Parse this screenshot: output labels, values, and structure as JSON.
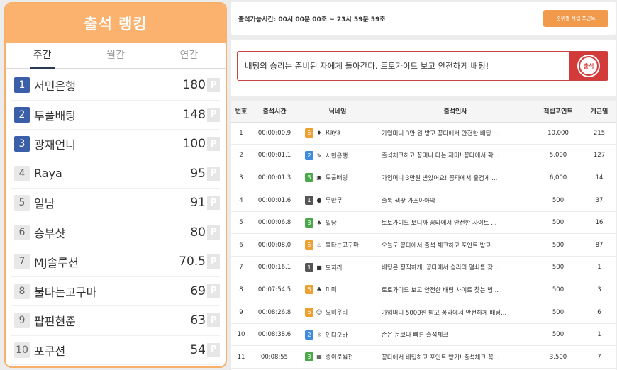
{
  "ranking": {
    "title": "출석 랭킹",
    "tabs": [
      {
        "label": "주간",
        "active": true
      },
      {
        "label": "월간",
        "active": false
      },
      {
        "label": "연간",
        "active": false
      }
    ],
    "point_badge": "P",
    "items": [
      {
        "rank": "1",
        "name": "서민은행",
        "points": "180"
      },
      {
        "rank": "2",
        "name": "투풀배팅",
        "points": "148"
      },
      {
        "rank": "3",
        "name": "광재언니",
        "points": "100"
      },
      {
        "rank": "4",
        "name": "Raya",
        "points": "95"
      },
      {
        "rank": "5",
        "name": "일남",
        "points": "91"
      },
      {
        "rank": "6",
        "name": "승부샷",
        "points": "80"
      },
      {
        "rank": "7",
        "name": "MJ솔루션",
        "points": "70.5"
      },
      {
        "rank": "8",
        "name": "불타는고구마",
        "points": "69"
      },
      {
        "rank": "9",
        "name": "팝핀현준",
        "points": "63"
      },
      {
        "rank": "10",
        "name": "포쿠션",
        "points": "54"
      }
    ]
  },
  "header": {
    "time_text": "출석가능시간: 00시 00분 00초 ~ 23시 59분 59초",
    "point_button": "순위별 적립 포인트"
  },
  "message": {
    "value": "배팅의 승리는 준비된 자에게 돌아간다. 토토가이드 보고 안전하게 배팅!",
    "submit_badge": "출석"
  },
  "table": {
    "headers": [
      "번호",
      "출석시간",
      "닉네임",
      "출석인사",
      "적립포인트",
      "개근일"
    ],
    "rows": [
      {
        "no": "1",
        "time": "00:00:00.9",
        "level": "5",
        "avatar": "♦",
        "nick": "Raya",
        "msg": "가입머니 3만 원 받고 꽁타에서 안전한 배팅 ...",
        "points": "10,000",
        "days": "215"
      },
      {
        "no": "2",
        "time": "00:00:01.1",
        "level": "2",
        "avatar": "✎",
        "nick": "서민은행",
        "msg": "출석체크하고 꽁머니 타는 재미! 꽁타에서 확...",
        "points": "5,000",
        "days": "127"
      },
      {
        "no": "3",
        "time": "00:00:01.3",
        "level": "3",
        "avatar": "▣",
        "nick": "투풀배팅",
        "msg": "가입머니 3만원 받았어요! 꽁타에서 출검게 ...",
        "points": "6,000",
        "days": "14"
      },
      {
        "no": "4",
        "time": "00:00:01.6",
        "level": "1",
        "avatar": "●",
        "nick": "무만무",
        "msg": "솔톡 잭팟 가즈아아악",
        "points": "500",
        "days": "37"
      },
      {
        "no": "5",
        "time": "00:00:06.8",
        "level": "3",
        "avatar": "♠",
        "nick": "일남",
        "msg": "토토가이드 보니까 꽁타에서 안전한 사이트 ...",
        "points": "500",
        "days": "16"
      },
      {
        "no": "6",
        "time": "00:00:08.0",
        "level": "5",
        "avatar": "♨",
        "nick": "불타는고구마",
        "msg": "오늘도 꽁타에서 출석 체크하고 포인트 받고...",
        "points": "500",
        "days": "87"
      },
      {
        "no": "7",
        "time": "00:00:16.1",
        "level": "1",
        "avatar": "■",
        "nick": "모지리",
        "msg": "배팅은 정직하게, 꽁타에서 승리의 열쇠를 찾...",
        "points": "500",
        "days": "1"
      },
      {
        "no": "8",
        "time": "00:07:54.5",
        "level": "5",
        "avatar": "♣",
        "nick": "미미",
        "msg": "토토가이드 보고 안전한 배팅 사이트 찾는 법...",
        "points": "500",
        "days": "3"
      },
      {
        "no": "9",
        "time": "00:08:26.8",
        "level": "5",
        "avatar": "☺",
        "nick": "오미우리",
        "msg": "가입머니 5000원 받고 꽁타에서 안전하게 배팅...",
        "points": "500",
        "days": "6"
      },
      {
        "no": "10",
        "time": "00:08:38.6",
        "level": "2",
        "avatar": "☼",
        "nick": "인디오바",
        "msg": "손은 눈보다 빠른 출석체크",
        "points": "500",
        "days": "1"
      },
      {
        "no": "11",
        "time": "00:08:55",
        "level": "3",
        "avatar": "▦",
        "nick": "종이로될전",
        "msg": "꽁타에서 배팅하고 포인트 받기! 출석체크 꼭...",
        "points": "3,500",
        "days": "7"
      }
    ]
  }
}
